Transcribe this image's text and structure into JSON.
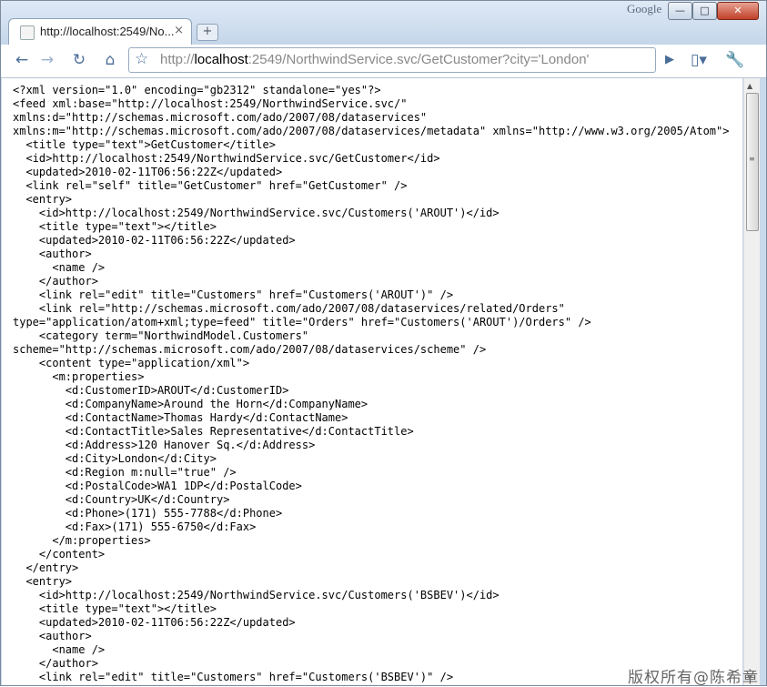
{
  "window": {
    "brand": "Google",
    "minimize_icon": "minimize-icon",
    "maximize_icon": "maximize-icon",
    "close_icon": "close-icon"
  },
  "tab": {
    "title": "http://localhost:2549/No...",
    "close_glyph": "×",
    "new_tab_glyph": "+"
  },
  "toolbar": {
    "back_glyph": "←",
    "forward_glyph": "→",
    "reload_glyph": "↻",
    "home_glyph": "⌂",
    "star_glyph": "☆",
    "go_glyph": "▶",
    "page_menu_glyph": "▯▾",
    "wrench_glyph": "🔧▾"
  },
  "address": {
    "scheme": "http://",
    "host": "localhost",
    "rest": ":2549/NorthwindService.svc/GetCustomer?city='London'"
  },
  "document": {
    "lines": [
      "<?xml version=\"1.0\" encoding=\"gb2312\" standalone=\"yes\"?>",
      "<feed xml:base=\"http://localhost:2549/NorthwindService.svc/\"",
      "xmlns:d=\"http://schemas.microsoft.com/ado/2007/08/dataservices\"",
      "xmlns:m=\"http://schemas.microsoft.com/ado/2007/08/dataservices/metadata\" xmlns=\"http://www.w3.org/2005/Atom\">",
      "  <title type=\"text\">GetCustomer</title>",
      "  <id>http://localhost:2549/NorthwindService.svc/GetCustomer</id>",
      "  <updated>2010-02-11T06:56:22Z</updated>",
      "  <link rel=\"self\" title=\"GetCustomer\" href=\"GetCustomer\" />",
      "  <entry>",
      "    <id>http://localhost:2549/NorthwindService.svc/Customers('AROUT')</id>",
      "    <title type=\"text\"></title>",
      "    <updated>2010-02-11T06:56:22Z</updated>",
      "    <author>",
      "      <name />",
      "    </author>",
      "    <link rel=\"edit\" title=\"Customers\" href=\"Customers('AROUT')\" />",
      "    <link rel=\"http://schemas.microsoft.com/ado/2007/08/dataservices/related/Orders\"",
      "type=\"application/atom+xml;type=feed\" title=\"Orders\" href=\"Customers('AROUT')/Orders\" />",
      "    <category term=\"NorthwindModel.Customers\"",
      "scheme=\"http://schemas.microsoft.com/ado/2007/08/dataservices/scheme\" />",
      "    <content type=\"application/xml\">",
      "      <m:properties>",
      "        <d:CustomerID>AROUT</d:CustomerID>",
      "        <d:CompanyName>Around the Horn</d:CompanyName>",
      "        <d:ContactName>Thomas Hardy</d:ContactName>",
      "        <d:ContactTitle>Sales Representative</d:ContactTitle>",
      "        <d:Address>120 Hanover Sq.</d:Address>",
      "        <d:City>London</d:City>",
      "        <d:Region m:null=\"true\" />",
      "        <d:PostalCode>WA1 1DP</d:PostalCode>",
      "        <d:Country>UK</d:Country>",
      "        <d:Phone>(171) 555-7788</d:Phone>",
      "        <d:Fax>(171) 555-6750</d:Fax>",
      "      </m:properties>",
      "    </content>",
      "  </entry>",
      "  <entry>",
      "    <id>http://localhost:2549/NorthwindService.svc/Customers('BSBEV')</id>",
      "    <title type=\"text\"></title>",
      "    <updated>2010-02-11T06:56:22Z</updated>",
      "    <author>",
      "      <name />",
      "    </author>",
      "    <link rel=\"edit\" title=\"Customers\" href=\"Customers('BSBEV')\" />"
    ]
  },
  "watermark": "版权所有@陈希章"
}
